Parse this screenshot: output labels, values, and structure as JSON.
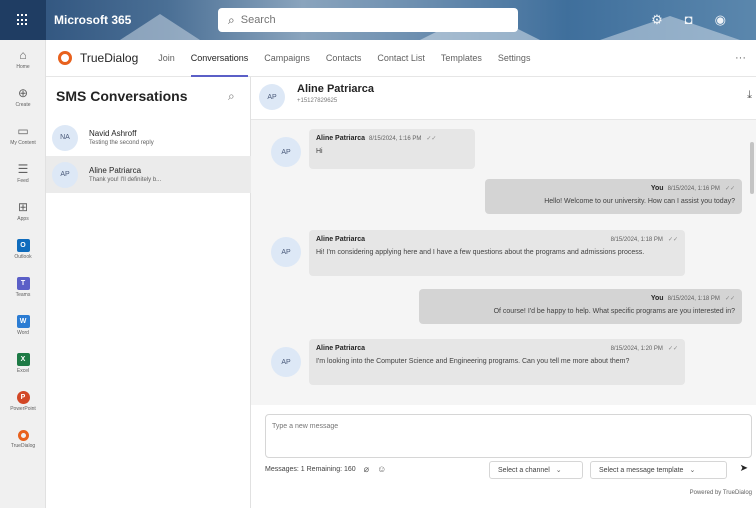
{
  "topbar": {
    "app_name": "Microsoft 365",
    "search_placeholder": "Search"
  },
  "rail": {
    "items": [
      {
        "label": "Home",
        "icon": "home-icon"
      },
      {
        "label": "Create",
        "icon": "plus-circle-icon"
      },
      {
        "label": "My Content",
        "icon": "folder-icon"
      },
      {
        "label": "Feed",
        "icon": "feed-icon"
      },
      {
        "label": "Apps",
        "icon": "apps-grid-icon"
      },
      {
        "label": "Outlook",
        "icon": "outlook-icon",
        "color": "#0f6cbd"
      },
      {
        "label": "Teams",
        "icon": "teams-icon",
        "color": "#5b5fc7"
      },
      {
        "label": "Word",
        "icon": "word-icon",
        "color": "#2b7cd3"
      },
      {
        "label": "Excel",
        "icon": "excel-icon",
        "color": "#1d7a45"
      },
      {
        "label": "PowerPoint",
        "icon": "powerpoint-icon",
        "color": "#d24726"
      },
      {
        "label": "TrueDialog",
        "icon": "truedialog-icon",
        "color": "#e8611d"
      }
    ]
  },
  "app_header": {
    "brand": "TrueDialog",
    "tabs": [
      "Join",
      "Conversations",
      "Campaigns",
      "Contacts",
      "Contact List",
      "Templates",
      "Settings"
    ],
    "active_tab": "Conversations"
  },
  "conversations": {
    "title": "SMS Conversations",
    "items": [
      {
        "initials": "NA",
        "name": "Navid Ashroff",
        "preview": "Testing the second reply"
      },
      {
        "initials": "AP",
        "name": "Aline Patriarca",
        "preview": "Thank you! I'll definitely b..."
      }
    ]
  },
  "chat": {
    "initials": "AP",
    "name": "Aline Patriarca",
    "phone": "+15127829625",
    "messages": [
      {
        "dir": "in",
        "sender": "Aline Patriarca",
        "time": "8/15/2024, 1:16 PM",
        "text": "Hi"
      },
      {
        "dir": "out",
        "sender": "You",
        "time": "8/15/2024, 1:16 PM",
        "text": "Hello! Welcome to our university. How can I assist you today?"
      },
      {
        "dir": "in",
        "sender": "Aline Patriarca",
        "time": "8/15/2024, 1:18 PM",
        "text": "Hi! I'm considering applying here and I have a few questions about the programs and admissions process."
      },
      {
        "dir": "out",
        "sender": "You",
        "time": "8/15/2024, 1:18 PM",
        "text": "Of course! I'd be happy to help. What specific programs are you interested in?"
      },
      {
        "dir": "in",
        "sender": "Aline Patriarca",
        "time": "8/15/2024, 1:20 PM",
        "text": "I'm looking into the Computer Science and Engineering programs. Can you tell me more about them?"
      }
    ],
    "composer_placeholder": "Type a new message",
    "counter": "Messages: 1 Remaining: 160",
    "channel_select": "Select a channel",
    "template_select": "Select a message template",
    "powered_by": "Powered by TrueDialog"
  },
  "colors": {
    "accent": "#5b5fc7",
    "brand_orange": "#e8611d",
    "avatar_bg": "#dde8f6"
  }
}
